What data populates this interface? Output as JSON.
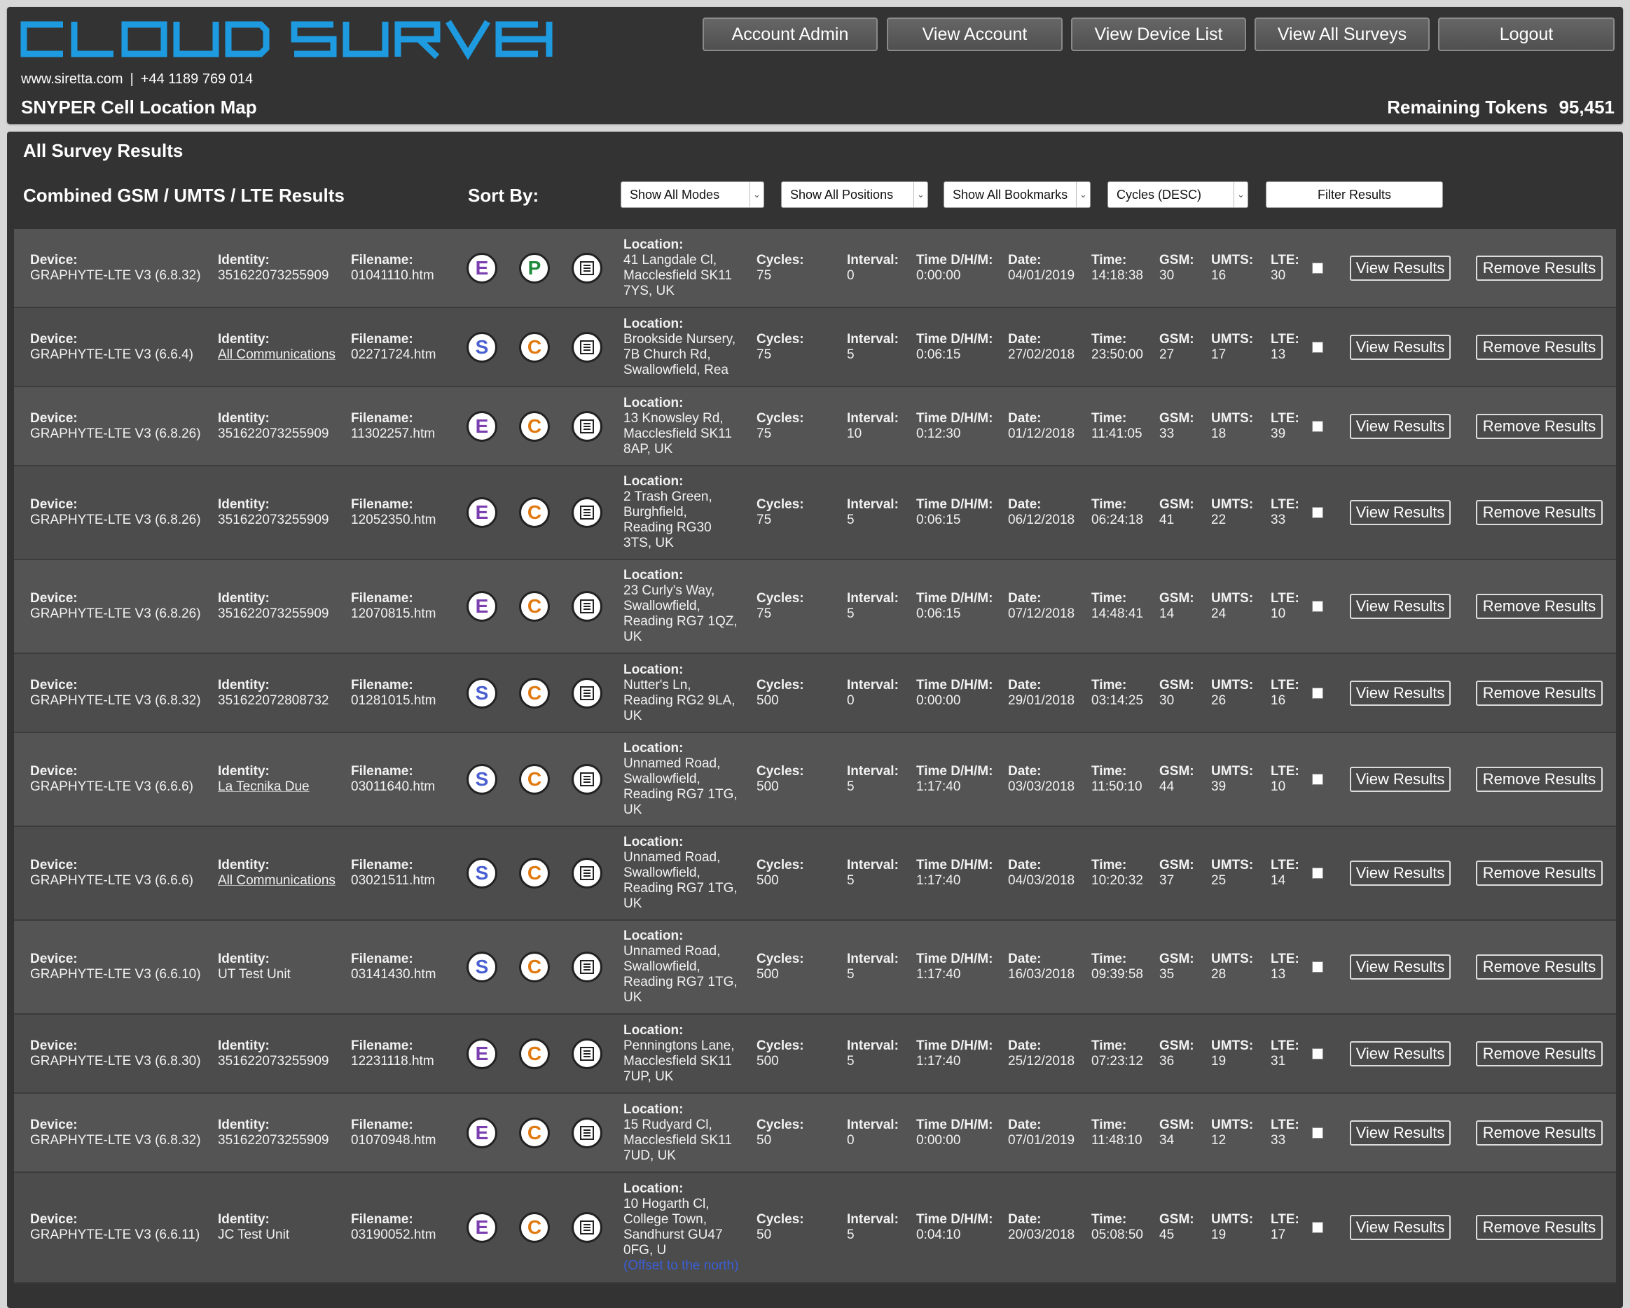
{
  "header": {
    "logo_text": "CLOUD SURVEY",
    "website": "www.siretta.com",
    "separator": "|",
    "phone": "+44 1189 769 014",
    "page_title": "SNYPER Cell Location Map",
    "tokens_label": "Remaining Tokens",
    "tokens_value": "95,451",
    "nav": [
      "Account Admin",
      "View Account",
      "View Device List",
      "View All Surveys",
      "Logout"
    ]
  },
  "main": {
    "section_title": "All Survey Results",
    "subtitle": "Combined GSM / UMTS / LTE Results",
    "sort_by_label": "Sort By:",
    "filters": {
      "modes": "Show All Modes",
      "positions": "Show All Positions",
      "bookmarks": "Show All Bookmarks",
      "order": "Cycles (DESC)"
    },
    "filter_button": "Filter Results"
  },
  "labels": {
    "device": "Device:",
    "identity": "Identity:",
    "filename": "Filename:",
    "location": "Location:",
    "cycles": "Cycles:",
    "interval": "Interval:",
    "time_dhm": "Time D/H/M:",
    "date": "Date:",
    "time": "Time:",
    "gsm": "GSM:",
    "umts": "UMTS:",
    "lte": "LTE:",
    "view_results": "View Results",
    "remove_results": "Remove Results"
  },
  "colors": {
    "badge_e": "#7b3fb0",
    "badge_s": "#4a5fd0",
    "badge_p": "#1e8a3a",
    "badge_c": "#e07a10",
    "logo": "#1e9be0"
  },
  "rows": [
    {
      "device": "GRAPHYTE-LTE V3 (6.8.32)",
      "identity": "351622073255909",
      "filename": "01041110.htm",
      "mode": "E",
      "pos": "P",
      "location": [
        "41 Langdale Cl,",
        "Macclesfield SK11",
        "7YS, UK"
      ],
      "cycles": "75",
      "interval": "0",
      "time_dhm": "0:00:00",
      "date": "04/01/2019",
      "time": "14:18:38",
      "gsm": "30",
      "umts": "16",
      "lte": "30"
    },
    {
      "device": "GRAPHYTE-LTE V3 (6.6.4)",
      "identity": "All Communications",
      "identity_link": true,
      "filename": "02271724.htm",
      "mode": "S",
      "pos": "C",
      "location": [
        "Brookside Nursery,",
        "7B Church Rd,",
        "Swallowfield, Rea"
      ],
      "cycles": "75",
      "interval": "5",
      "time_dhm": "0:06:15",
      "date": "27/02/2018",
      "time": "23:50:00",
      "gsm": "27",
      "umts": "17",
      "lte": "13"
    },
    {
      "device": "GRAPHYTE-LTE V3 (6.8.26)",
      "identity": "351622073255909",
      "filename": "11302257.htm",
      "mode": "E",
      "pos": "C",
      "location": [
        "13 Knowsley Rd,",
        "Macclesfield SK11",
        "8AP, UK"
      ],
      "cycles": "75",
      "interval": "10",
      "time_dhm": "0:12:30",
      "date": "01/12/2018",
      "time": "11:41:05",
      "gsm": "33",
      "umts": "18",
      "lte": "39"
    },
    {
      "device": "GRAPHYTE-LTE V3 (6.8.26)",
      "identity": "351622073255909",
      "filename": "12052350.htm",
      "mode": "E",
      "pos": "C",
      "location": [
        "2 Trash Green,",
        "Burghfield,",
        "Reading RG30",
        "3TS, UK"
      ],
      "cycles": "75",
      "interval": "5",
      "time_dhm": "0:06:15",
      "date": "06/12/2018",
      "time": "06:24:18",
      "gsm": "41",
      "umts": "22",
      "lte": "33"
    },
    {
      "device": "GRAPHYTE-LTE V3 (6.8.26)",
      "identity": "351622073255909",
      "filename": "12070815.htm",
      "mode": "E",
      "pos": "C",
      "location": [
        "23 Curly's Way,",
        "Swallowfield,",
        "Reading RG7 1QZ,",
        "UK"
      ],
      "cycles": "75",
      "interval": "5",
      "time_dhm": "0:06:15",
      "date": "07/12/2018",
      "time": "14:48:41",
      "gsm": "14",
      "umts": "24",
      "lte": "10"
    },
    {
      "device": "GRAPHYTE-LTE V3 (6.8.32)",
      "identity": "351622072808732",
      "filename": "01281015.htm",
      "mode": "S",
      "pos": "C",
      "location": [
        "Nutter's Ln,",
        "Reading RG2 9LA,",
        "UK"
      ],
      "cycles": "500",
      "interval": "0",
      "time_dhm": "0:00:00",
      "date": "29/01/2018",
      "time": "03:14:25",
      "gsm": "30",
      "umts": "26",
      "lte": "16"
    },
    {
      "device": "GRAPHYTE-LTE V3 (6.6.6)",
      "identity": "La Tecnika Due",
      "identity_link": true,
      "filename": "03011640.htm",
      "mode": "S",
      "pos": "C",
      "location": [
        "Unnamed Road,",
        "Swallowfield,",
        "Reading RG7 1TG,",
        "UK"
      ],
      "cycles": "500",
      "interval": "5",
      "time_dhm": "1:17:40",
      "date": "03/03/2018",
      "time": "11:50:10",
      "gsm": "44",
      "umts": "39",
      "lte": "10"
    },
    {
      "device": "GRAPHYTE-LTE V3 (6.6.6)",
      "identity": "All Communications",
      "identity_link": true,
      "filename": "03021511.htm",
      "mode": "S",
      "pos": "C",
      "location": [
        "Unnamed Road,",
        "Swallowfield,",
        "Reading RG7 1TG,",
        "UK"
      ],
      "cycles": "500",
      "interval": "5",
      "time_dhm": "1:17:40",
      "date": "04/03/2018",
      "time": "10:20:32",
      "gsm": "37",
      "umts": "25",
      "lte": "14"
    },
    {
      "device": "GRAPHYTE-LTE V3 (6.6.10)",
      "identity": "UT Test Unit",
      "filename": "03141430.htm",
      "mode": "S",
      "pos": "C",
      "location": [
        "Unnamed Road,",
        "Swallowfield,",
        "Reading RG7 1TG,",
        "UK"
      ],
      "cycles": "500",
      "interval": "5",
      "time_dhm": "1:17:40",
      "date": "16/03/2018",
      "time": "09:39:58",
      "gsm": "35",
      "umts": "28",
      "lte": "13"
    },
    {
      "device": "GRAPHYTE-LTE V3 (6.8.30)",
      "identity": "351622073255909",
      "filename": "12231118.htm",
      "mode": "E",
      "pos": "C",
      "location": [
        "Penningtons Lane,",
        "Macclesfield SK11",
        "7UP, UK"
      ],
      "cycles": "500",
      "interval": "5",
      "time_dhm": "1:17:40",
      "date": "25/12/2018",
      "time": "07:23:12",
      "gsm": "36",
      "umts": "19",
      "lte": "31"
    },
    {
      "device": "GRAPHYTE-LTE V3 (6.8.32)",
      "identity": "351622073255909",
      "filename": "01070948.htm",
      "mode": "E",
      "pos": "C",
      "location": [
        "15 Rudyard Cl,",
        "Macclesfield SK11",
        "7UD, UK"
      ],
      "cycles": "50",
      "interval": "0",
      "time_dhm": "0:00:00",
      "date": "07/01/2019",
      "time": "11:48:10",
      "gsm": "34",
      "umts": "12",
      "lte": "33"
    },
    {
      "device": "GRAPHYTE-LTE V3 (6.6.11)",
      "identity": "JC Test Unit",
      "filename": "03190052.htm",
      "mode": "E",
      "pos": "C",
      "location": [
        "10 Hogarth Cl,",
        "College Town,",
        "Sandhurst GU47",
        "0FG, U"
      ],
      "location_note": "(Offset to the north)",
      "cycles": "50",
      "interval": "5",
      "time_dhm": "0:04:10",
      "date": "20/03/2018",
      "time": "05:08:50",
      "gsm": "45",
      "umts": "19",
      "lte": "17"
    }
  ]
}
